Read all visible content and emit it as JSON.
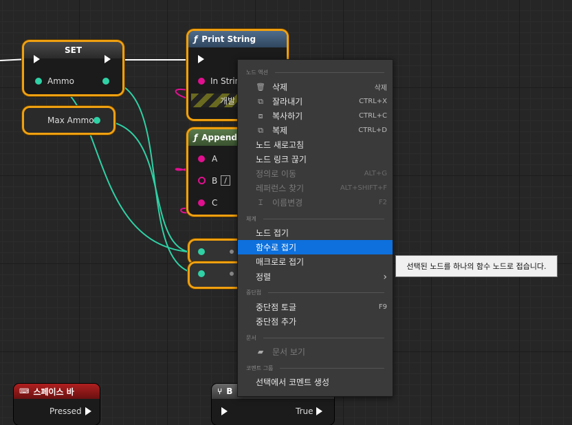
{
  "nodes": {
    "set": {
      "title": "SET",
      "pin_ammo": "Ammo"
    },
    "max_ammo": {
      "label": "Max Ammo"
    },
    "print_string": {
      "title": "Print String",
      "pin_in": "In Strin",
      "dev_label": "개발"
    },
    "append": {
      "title": "Append",
      "pin_a": "A",
      "pin_b": "B",
      "b_value": "/",
      "pin_c": "C"
    },
    "space_bar": {
      "title": "스페이스 바",
      "pin_pressed": "Pressed"
    },
    "branch": {
      "title": "B",
      "pin_true": "True"
    }
  },
  "context_menu": {
    "sections": {
      "node_actions": "노드 액션",
      "organization": "체계",
      "breakpoints": "중단점",
      "documentation": "문서",
      "comment_group": "코멘트 그룹"
    },
    "items": {
      "delete": {
        "label": "삭제",
        "shortcut": "삭제",
        "icon": "trash-icon"
      },
      "cut": {
        "label": "잘라내기",
        "shortcut": "CTRL+X",
        "icon": "cut-icon"
      },
      "copy": {
        "label": "복사하기",
        "shortcut": "CTRL+C",
        "icon": "copy-icon"
      },
      "duplicate": {
        "label": "복제",
        "shortcut": "CTRL+D",
        "icon": "duplicate-icon"
      },
      "refresh": {
        "label": "노드 새로고침"
      },
      "break_links": {
        "label": "노드 링크 끊기"
      },
      "goto_def": {
        "label": "정의로 이동",
        "shortcut": "ALT+G"
      },
      "find_refs": {
        "label": "레퍼런스 찾기",
        "shortcut": "ALT+SHIFT+F"
      },
      "rename": {
        "label": "이름변경",
        "shortcut": "F2",
        "icon": "rename-icon"
      },
      "collapse_nodes": {
        "label": "노드 접기"
      },
      "collapse_function": {
        "label": "함수로 접기"
      },
      "collapse_macro": {
        "label": "매크로로 접기"
      },
      "alignment": {
        "label": "정렬"
      },
      "toggle_breakpoint": {
        "label": "중단점 토글",
        "shortcut": "F9"
      },
      "add_breakpoint": {
        "label": "중단점 추가"
      },
      "view_docs": {
        "label": "문서 보기",
        "icon": "docs-icon"
      },
      "create_comment": {
        "label": "선택에서 코멘트 생성"
      }
    }
  },
  "tooltip": "선택된 노드를 하나의 함수 노드로 접습니다.",
  "colors": {
    "selection": "#f0a010",
    "highlight": "#0d70dc",
    "wire_float": "#2fd1a5",
    "wire_string": "#e0108f"
  }
}
